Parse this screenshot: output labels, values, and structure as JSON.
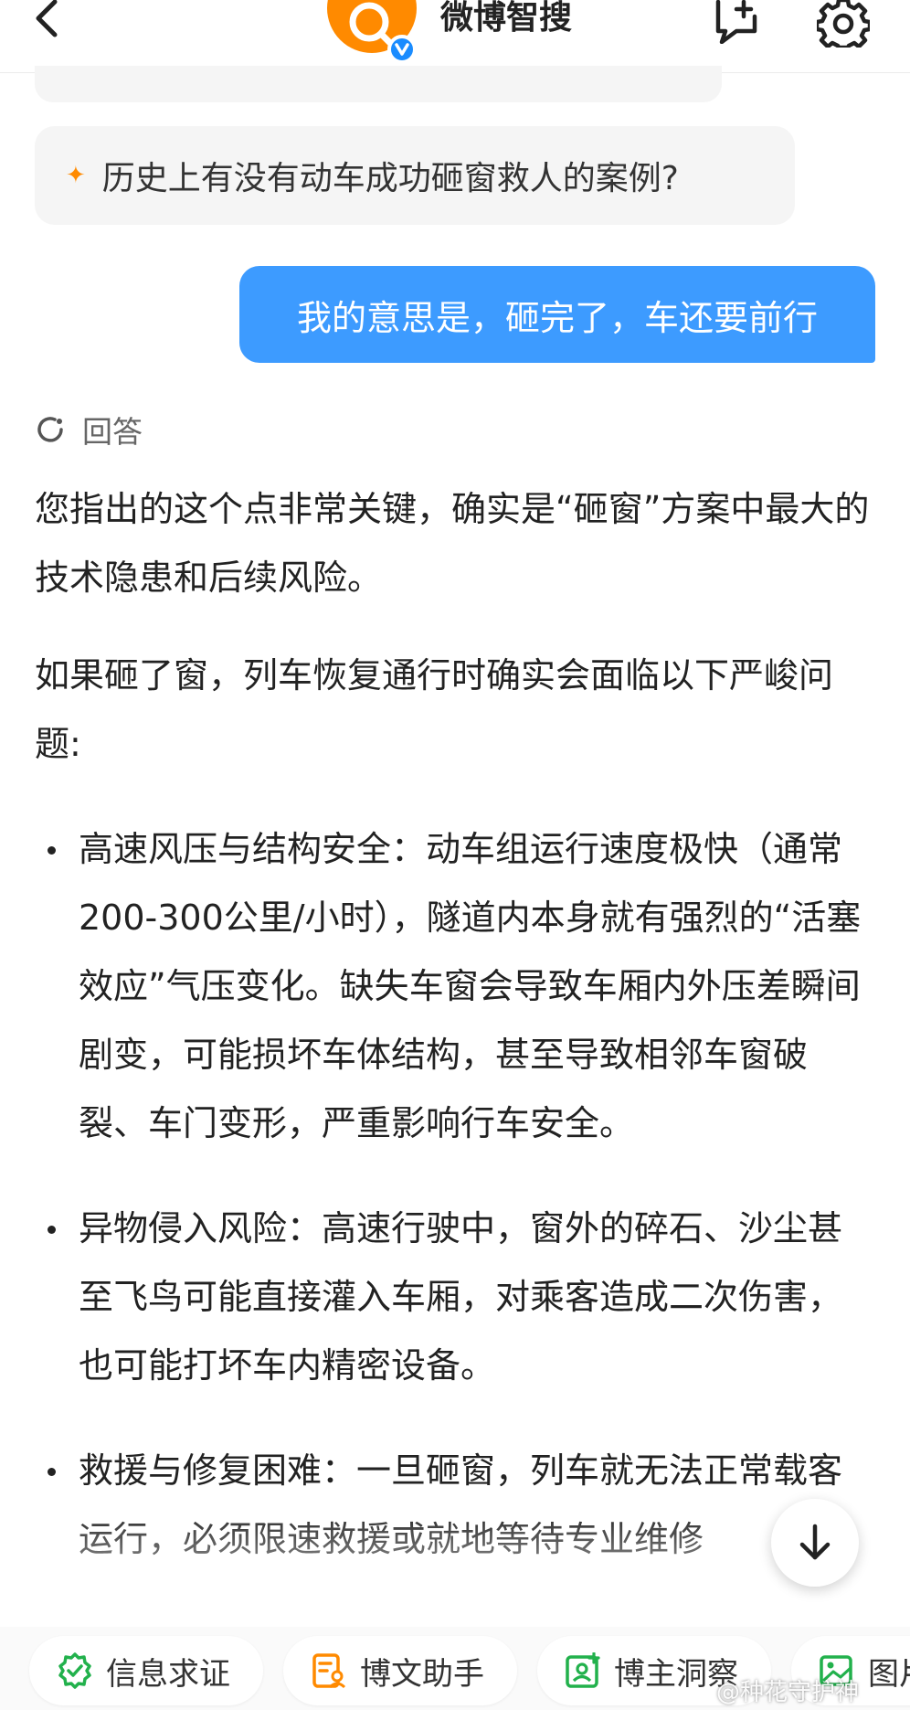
{
  "header": {
    "title": "微博智搜",
    "back_icon": "chevron-left-icon",
    "chat_icon": "chat-plus-icon",
    "settings_icon": "gear-icon"
  },
  "suggestion": {
    "text": "历史上有没有动车成功砸窗救人的案例?"
  },
  "user_message": {
    "text": "我的意思是，砸完了，车还要前行"
  },
  "answer": {
    "label": "回答",
    "paragraphs": [
      "您指出的这个点非常关键，确实是“砸窗”方案中最大的技术隐患和后续风险。",
      "如果砸了窗，列车恢复通行时确实会面临以下严峻问题:"
    ],
    "bullets": [
      "高速风压与结构安全：动车组运行速度极快（通常200-300公里/小时），隧道内本身就有强烈的“活塞效应”气压变化。缺失车窗会导致车厢内外压差瞬间剧变，可能损坏车体结构，甚至导致相邻车窗破裂、车门变形，严重影响行车安全。",
      "异物侵入风险：高速行驶中，窗外的碎石、沙尘甚至飞鸟可能直接灌入车厢，对乘客造成二次伤害，也可能打坏车内精密设备。",
      "救援与修复困难：一旦砸窗，列车就无法正常载客运行，必须限速救援或就地等待专业维修"
    ]
  },
  "bottom_bar": {
    "chips": [
      {
        "label": "信息求证",
        "icon": "shield-check-icon"
      },
      {
        "label": "博文助手",
        "icon": "document-user-icon"
      },
      {
        "label": "博主洞察",
        "icon": "user-card-icon"
      },
      {
        "label": "图片",
        "icon": "image-icon"
      }
    ]
  },
  "watermark": "@种花守护神",
  "colors": {
    "accent_orange": "#ff8a00",
    "user_bubble": "#3d9bff",
    "verified_blue": "#1a8cff",
    "chip_icon_green": "#22b14c",
    "chip_icon_orange": "#ff8a00"
  }
}
